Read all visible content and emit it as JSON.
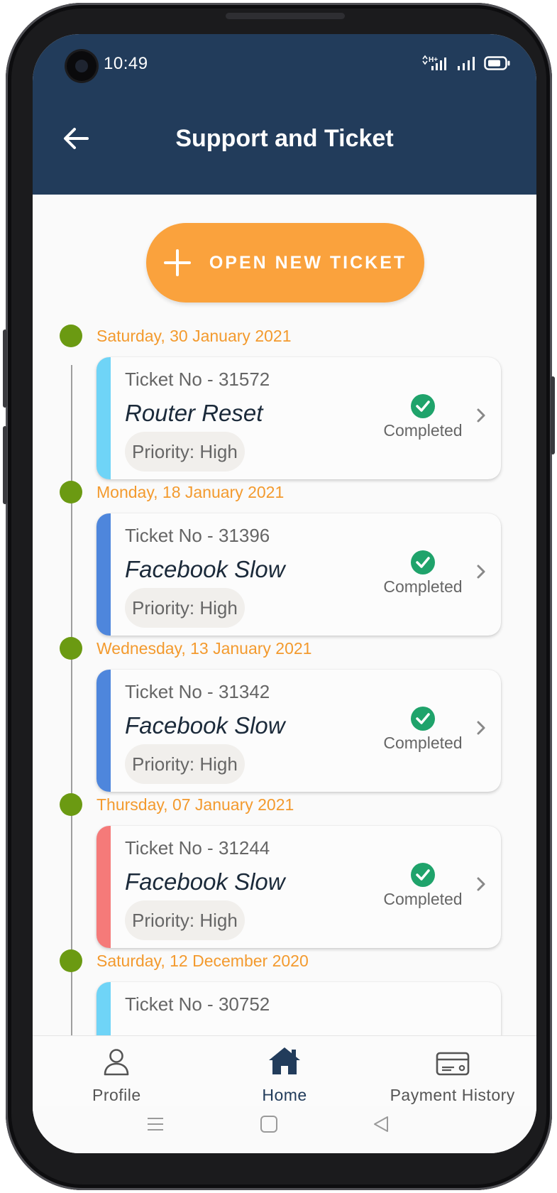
{
  "status_bar": {
    "time": "10:49",
    "network": "H+"
  },
  "app_bar": {
    "title": "Support and Ticket",
    "back_icon": "arrow-left-icon"
  },
  "open_ticket_button": {
    "label": "OPEN NEW TICKET",
    "icon": "plus-icon",
    "color": "#faa23d"
  },
  "tickets": [
    {
      "date": "Saturday, 30 January 2021",
      "ticket_no": "Ticket No - 31572",
      "subject": "Router Reset",
      "priority": "Priority: High",
      "status": "Completed",
      "stripe_color": "#6fd4f7"
    },
    {
      "date": "Monday, 18 January 2021",
      "ticket_no": "Ticket No - 31396",
      "subject": "Facebook Slow",
      "priority": "Priority: High",
      "status": "Completed",
      "stripe_color": "#4e86dc"
    },
    {
      "date": "Wednesday, 13 January 2021",
      "ticket_no": "Ticket No - 31342",
      "subject": "Facebook Slow",
      "priority": "Priority: High",
      "status": "Completed",
      "stripe_color": "#4e86dc"
    },
    {
      "date": "Thursday, 07 January 2021",
      "ticket_no": "Ticket No - 31244",
      "subject": "Facebook Slow",
      "priority": "Priority: High",
      "status": "Completed",
      "stripe_color": "#f57a79"
    },
    {
      "date": "Saturday, 12 December 2020",
      "ticket_no": "Ticket No - 30752",
      "subject": "",
      "priority": "",
      "status": "",
      "stripe_color": "#6fd4f7"
    }
  ],
  "bottom_nav": {
    "items": [
      {
        "label": "Profile",
        "icon": "person-icon",
        "active": false
      },
      {
        "label": "Home",
        "icon": "home-icon",
        "active": true
      },
      {
        "label": "Payment History",
        "icon": "credit-card-icon",
        "active": false
      }
    ]
  },
  "colors": {
    "header": "#223c5b",
    "date_text": "#f39a2e",
    "timeline_dot": "#6b9a12",
    "completed_check": "#1fa36b"
  }
}
